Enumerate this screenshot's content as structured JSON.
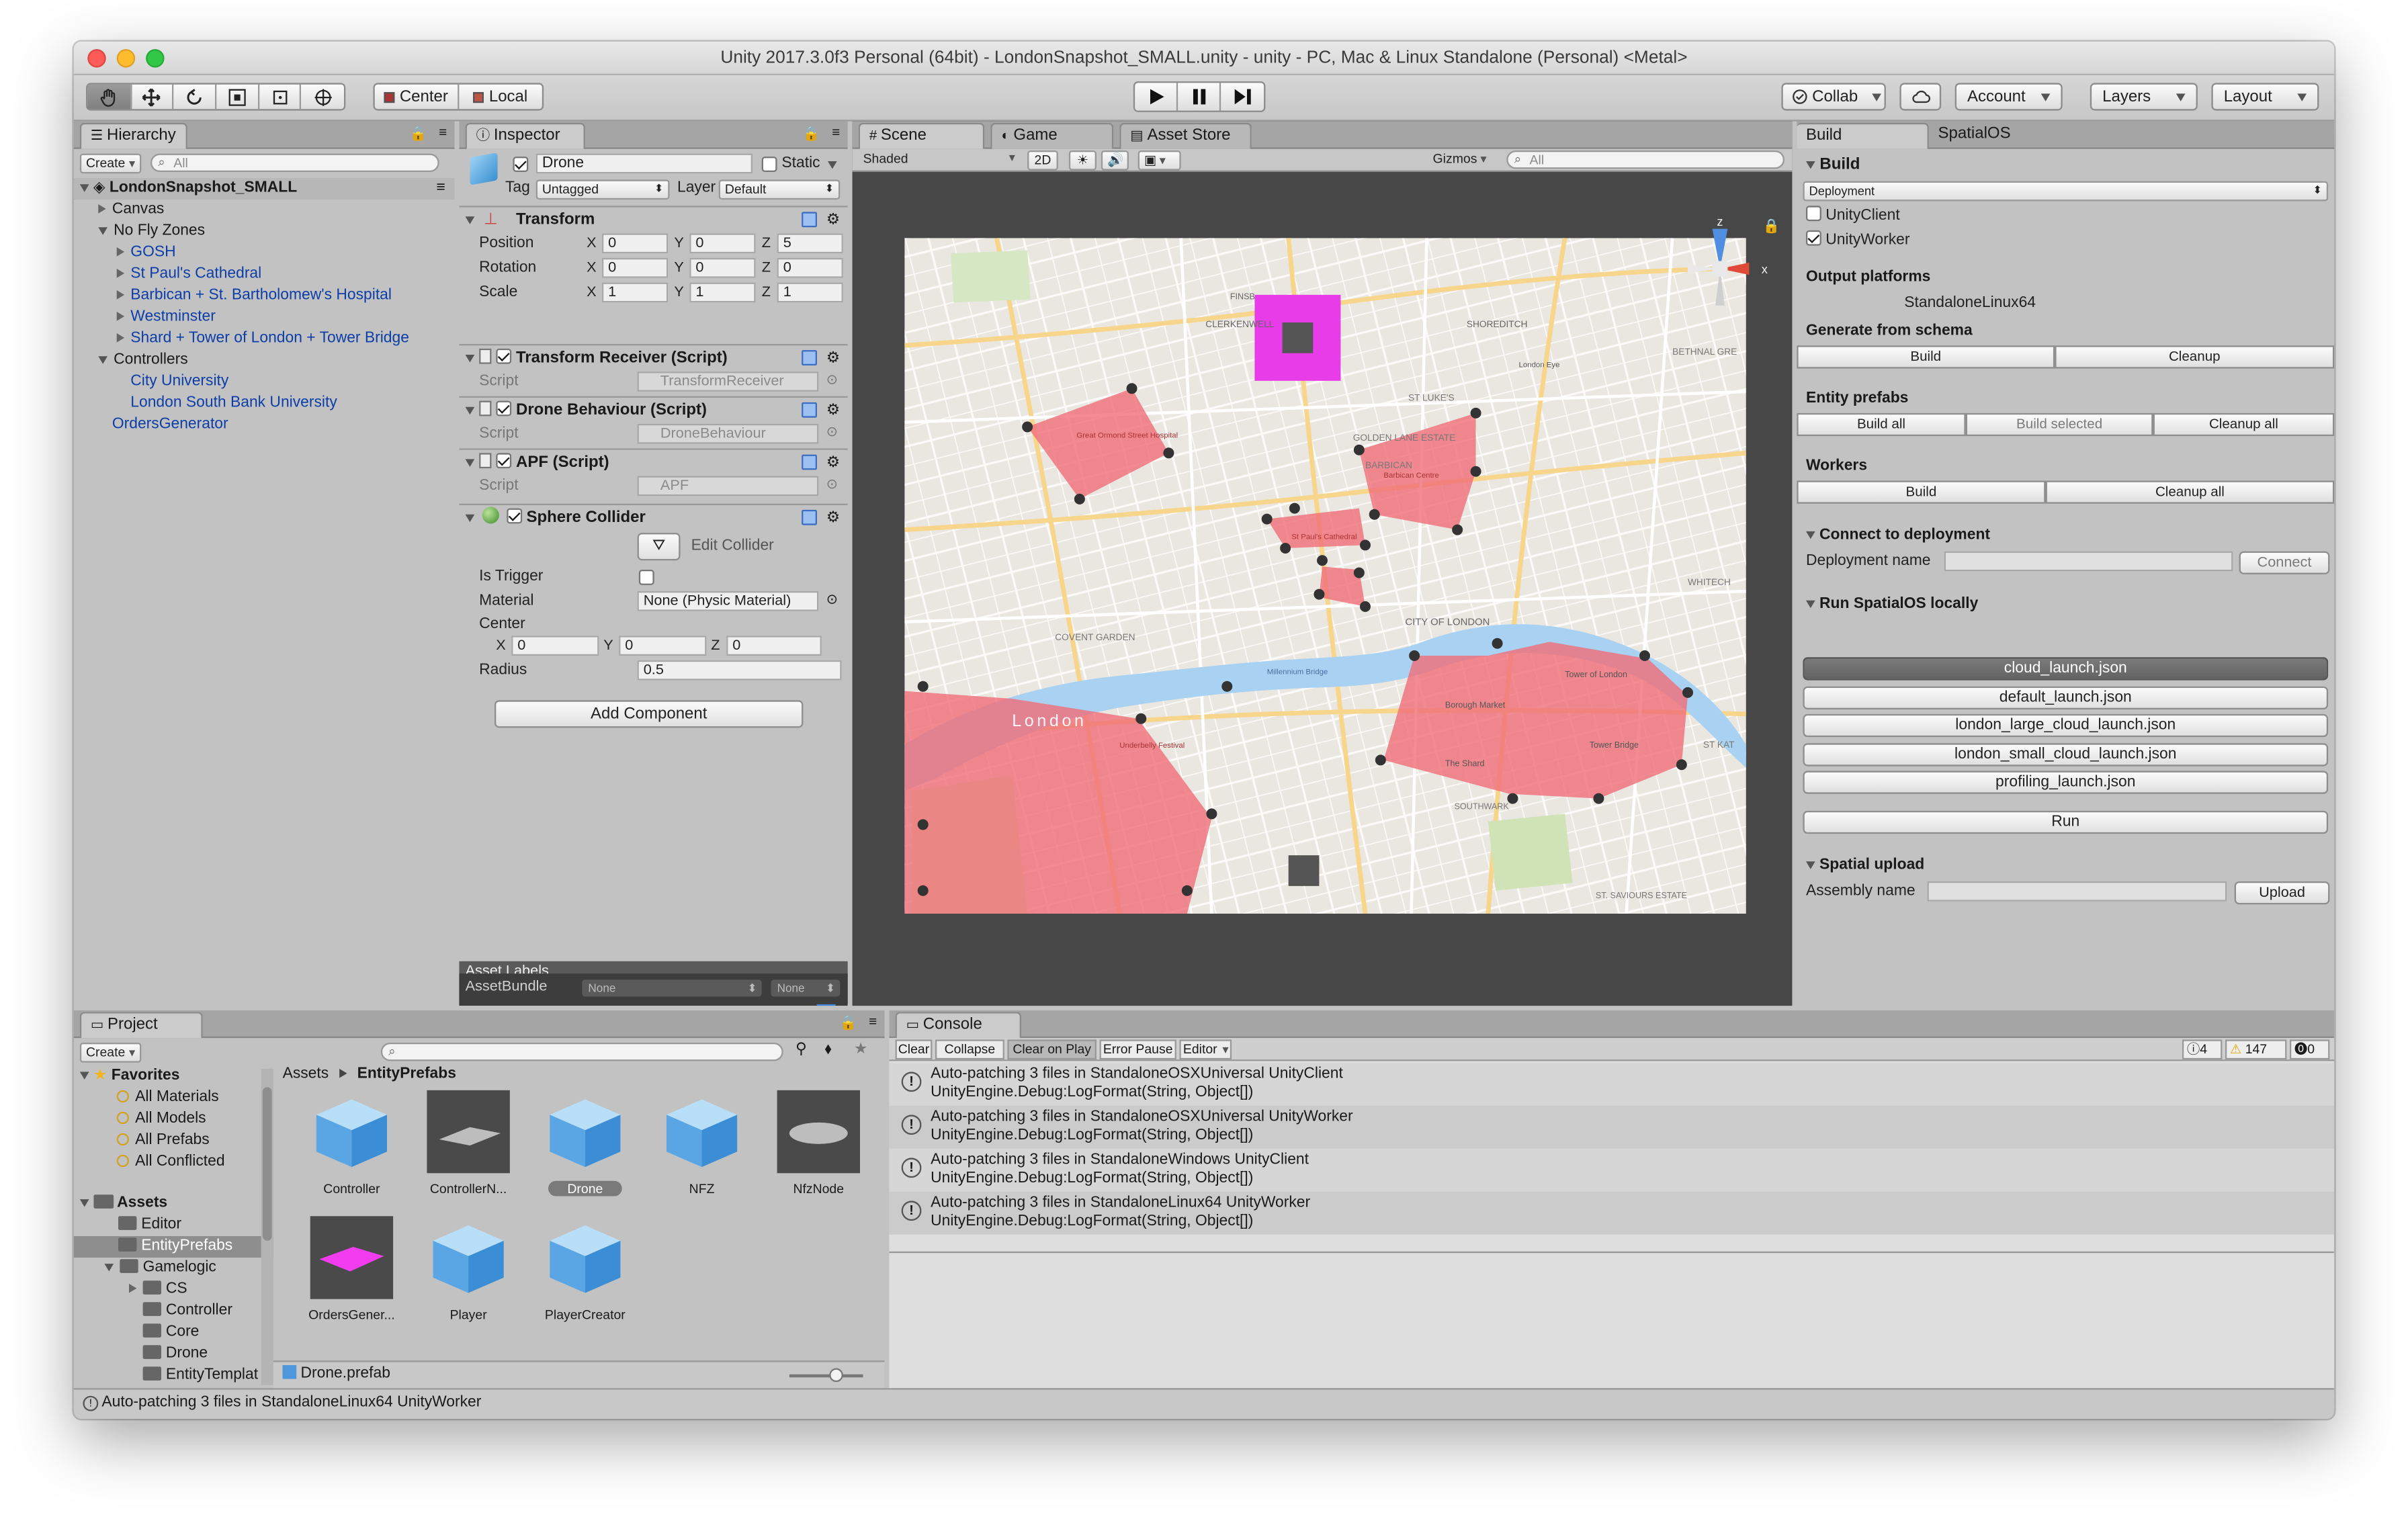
{
  "window": {
    "title": "Unity 2017.3.0f3 Personal (64bit) - LondonSnapshot_SMALL.unity - unity - PC, Mac & Linux Standalone (Personal) <Metal>",
    "traffic_colors": [
      "#fc5b57",
      "#fcbc2e",
      "#33c748"
    ]
  },
  "toolbar": {
    "pivot": "Center",
    "space": "Local",
    "collab": "Collab",
    "account": "Account",
    "layers": "Layers",
    "layout": "Layout"
  },
  "hierarchy": {
    "tab": "Hierarchy",
    "create": "Create",
    "search_placeholder": "All",
    "scene": "LondonSnapshot_SMALL",
    "items": [
      {
        "label": "Canvas",
        "depth": 1,
        "arrow": "right",
        "blue": false
      },
      {
        "label": "No Fly Zones",
        "depth": 1,
        "arrow": "down",
        "blue": false
      },
      {
        "label": "GOSH",
        "depth": 2,
        "arrow": "right",
        "blue": true
      },
      {
        "label": "St Paul's Cathedral",
        "depth": 2,
        "arrow": "right",
        "blue": true
      },
      {
        "label": "Barbican + St. Bartholomew's Hospital",
        "depth": 2,
        "arrow": "right",
        "blue": true
      },
      {
        "label": "Westminster",
        "depth": 2,
        "arrow": "right",
        "blue": true
      },
      {
        "label": "Shard + Tower of London + Tower Bridge",
        "depth": 2,
        "arrow": "right",
        "blue": true
      },
      {
        "label": "Controllers",
        "depth": 1,
        "arrow": "down",
        "blue": false
      },
      {
        "label": "City University",
        "depth": 2,
        "arrow": "",
        "blue": true
      },
      {
        "label": "London South Bank University",
        "depth": 2,
        "arrow": "",
        "blue": true
      },
      {
        "label": "OrdersGenerator",
        "depth": 1,
        "arrow": "",
        "blue": true
      }
    ]
  },
  "inspector": {
    "tab": "Inspector",
    "name": "Drone",
    "static": "Static",
    "tag_label": "Tag",
    "tag": "Untagged",
    "layer_label": "Layer",
    "layer": "Default",
    "transform": {
      "title": "Transform",
      "position_label": "Position",
      "rotation_label": "Rotation",
      "scale_label": "Scale",
      "position": [
        "0",
        "0",
        "5"
      ],
      "rotation": [
        "0",
        "0",
        "0"
      ],
      "scale": [
        "1",
        "1",
        "1"
      ],
      "axes": [
        "X",
        "Y",
        "Z"
      ]
    },
    "script_label": "Script",
    "scripts": [
      {
        "title": "Transform Receiver (Script)",
        "value": "TransformReceiver"
      },
      {
        "title": "Drone Behaviour (Script)",
        "value": "DroneBehaviour"
      },
      {
        "title": "APF (Script)",
        "value": "APF"
      }
    ],
    "collider": {
      "title": "Sphere Collider",
      "edit": "Edit Collider",
      "is_trigger": "Is Trigger",
      "material_label": "Material",
      "material": "None (Physic Material)",
      "center": "Center",
      "center_values": [
        "0",
        "0",
        "0"
      ],
      "radius_label": "Radius",
      "radius": "0.5"
    },
    "add_component": "Add Component",
    "asset_labels": "Asset Labels",
    "asset_bundle": "AssetBundle",
    "bundle_value": "None",
    "variant_value": "None"
  },
  "scene": {
    "tabs": [
      "Scene",
      "Game",
      "Asset Store"
    ],
    "shading": "Shaded",
    "mode_2d": "2D",
    "gizmos": "Gizmos",
    "search_placeholder": "All",
    "map_labels": [
      "London",
      "CLERKENWELL",
      "SHOREDITCH",
      "GOLDEN LANE ESTATE",
      "BARBICAN",
      "CITY OF LONDON",
      "COVENT GARDEN",
      "WHITECH",
      "ST KAT",
      "SOUTHWARK",
      "ST. SAVIOURS ESTATE",
      "FINSB",
      "ST LUKE'S",
      "BETHNAL GRE",
      "Tower of London",
      "Borough Market",
      "The Shard",
      "Tower Bridge",
      "Millennium Bridge",
      "London Eye",
      "Great Ormond Street Hospital",
      "Barbican Centre",
      "St Paul's Cathedral",
      "Underbelly Festival"
    ]
  },
  "build": {
    "tabs": [
      "Build",
      "SpatialOS"
    ],
    "section": "Build",
    "target": "Deployment",
    "unity_client": "UnityClient",
    "unity_worker": "UnityWorker",
    "output_platforms": "Output platforms",
    "platform": "StandaloneLinux64",
    "generate": "Generate from schema",
    "build": "Build",
    "cleanup": "Cleanup",
    "entity_prefabs": "Entity prefabs",
    "build_all": "Build all",
    "build_selected": "Build selected",
    "cleanup_all": "Cleanup all",
    "workers": "Workers",
    "connect_section": "Connect to deployment",
    "deployment_name": "Deployment name",
    "connect": "Connect",
    "run_section": "Run SpatialOS locally",
    "launch_files": [
      "cloud_launch.json",
      "default_launch.json",
      "london_large_cloud_launch.json",
      "london_small_cloud_launch.json",
      "profiling_launch.json"
    ],
    "run": "Run",
    "upload_section": "Spatial upload",
    "assembly_name": "Assembly name",
    "upload": "Upload"
  },
  "project": {
    "tab": "Project",
    "create": "Create",
    "favorites": "Favorites",
    "fav_items": [
      "All Materials",
      "All Models",
      "All Prefabs",
      "All Conflicted"
    ],
    "assets": "Assets",
    "tree": [
      {
        "label": "Editor",
        "depth": 1,
        "arrow": ""
      },
      {
        "label": "EntityPrefabs",
        "depth": 1,
        "arrow": "",
        "selected": true
      },
      {
        "label": "Gamelogic",
        "depth": 1,
        "arrow": "down"
      },
      {
        "label": "CS",
        "depth": 2,
        "arrow": "right"
      },
      {
        "label": "Controller",
        "depth": 2,
        "arrow": ""
      },
      {
        "label": "Core",
        "depth": 2,
        "arrow": ""
      },
      {
        "label": "Drone",
        "depth": 2,
        "arrow": ""
      },
      {
        "label": "EntityTemplat",
        "depth": 2,
        "arrow": ""
      }
    ],
    "breadcrumb_root": "Assets",
    "breadcrumb_leaf": "EntityPrefabs",
    "items": [
      {
        "label": "Controller",
        "kind": "cube"
      },
      {
        "label": "ControllerN...",
        "kind": "plane-gray"
      },
      {
        "label": "Drone",
        "kind": "cube",
        "selected": true
      },
      {
        "label": "NFZ",
        "kind": "cube"
      },
      {
        "label": "NfzNode",
        "kind": "disc"
      },
      {
        "label": "OrdersGener...",
        "kind": "plane-magenta"
      },
      {
        "label": "Player",
        "kind": "cube"
      },
      {
        "label": "PlayerCreator",
        "kind": "cube"
      }
    ],
    "footer": "Drone.prefab"
  },
  "console": {
    "tab": "Console",
    "buttons": [
      "Clear",
      "Collapse",
      "Clear on Play",
      "Error Pause",
      "Editor"
    ],
    "counts": {
      "info": "4",
      "warning": "147",
      "error": "0"
    },
    "rows": [
      {
        "line1": "Auto-patching 3 files in StandaloneOSXUniversal UnityClient",
        "line2": "UnityEngine.Debug:LogFormat(String, Object[])"
      },
      {
        "line1": "Auto-patching 3 files in StandaloneOSXUniversal UnityWorker",
        "line2": "UnityEngine.Debug:LogFormat(String, Object[])"
      },
      {
        "line1": "Auto-patching 3 files in StandaloneWindows UnityClient",
        "line2": "UnityEngine.Debug:LogFormat(String, Object[])"
      },
      {
        "line1": "Auto-patching 3 files in StandaloneLinux64 UnityWorker",
        "line2": "UnityEngine.Debug:LogFormat(String, Object[])"
      }
    ]
  },
  "status_bar": "Auto-patching 3 files in StandaloneLinux64 UnityWorker",
  "colors": {
    "zone": "#f06e78",
    "magenta": "#e83ce8",
    "panel": "#c2c2c2",
    "selected": "#3e7de0"
  }
}
